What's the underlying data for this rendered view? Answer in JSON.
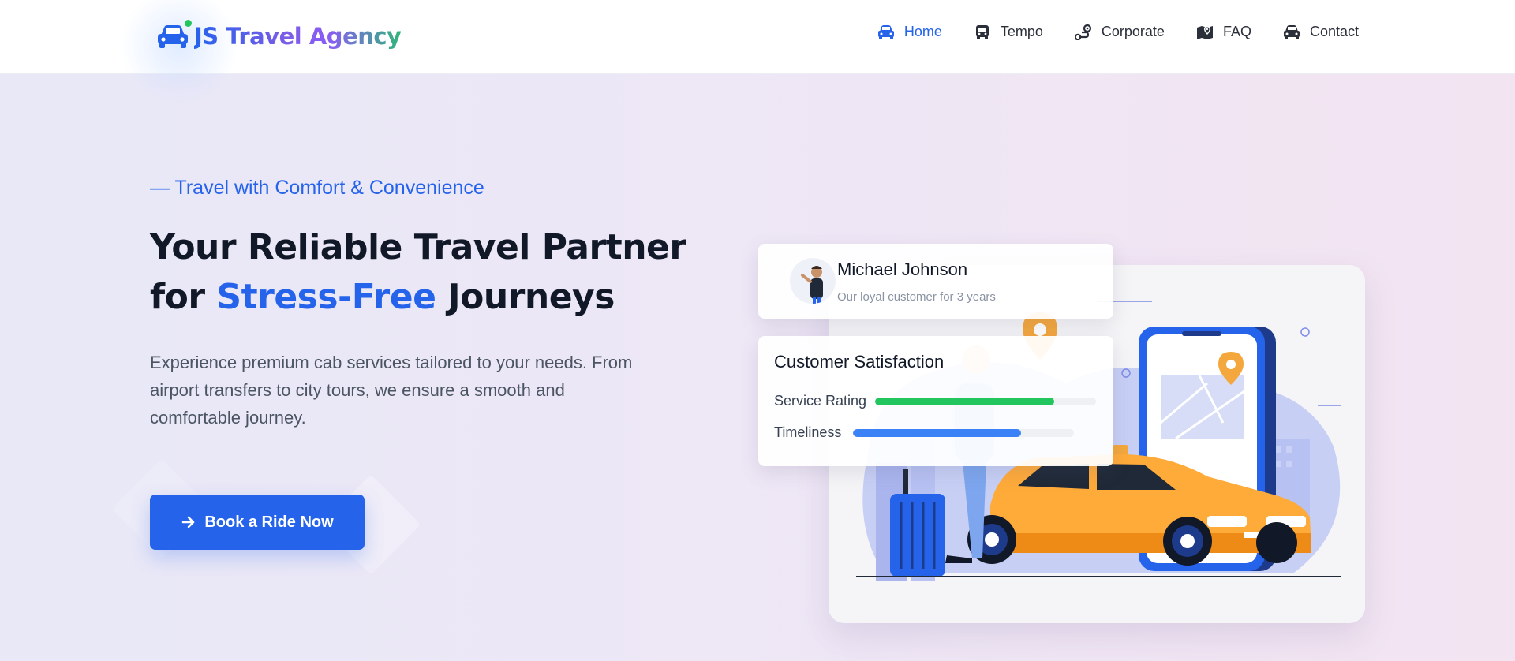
{
  "header": {
    "brand": "JS Travel Agency",
    "nav": [
      {
        "label": "Home",
        "icon": "car-front-icon",
        "active": true
      },
      {
        "label": "Tempo",
        "icon": "van-icon",
        "active": false
      },
      {
        "label": "Corporate",
        "icon": "route-icon",
        "active": false
      },
      {
        "label": "FAQ",
        "icon": "map-pin-icon",
        "active": false
      },
      {
        "label": "Contact",
        "icon": "car-icon",
        "active": false
      }
    ]
  },
  "hero": {
    "tagline": "— Travel with Comfort & Convenience",
    "headline_line1": "Your Reliable Travel Partner",
    "headline_for": "for ",
    "headline_accent": "Stress-Free",
    "headline_end": " Journeys",
    "description": "Experience premium cab services tailored to your needs. From airport transfers to city tours, we ensure a smooth and comfortable journey.",
    "cta_label": "Book a Ride Now"
  },
  "customer_card": {
    "name": "Michael Johnson",
    "subtitle": "Our loyal customer for 3 years"
  },
  "satisfaction": {
    "title": "Customer Satisfaction",
    "metrics": [
      {
        "label": "Service Rating",
        "value": 0.81,
        "color": "#22c55e"
      },
      {
        "label": "Timeliness",
        "value": 0.76,
        "color": "#3b82f6"
      }
    ]
  },
  "colors": {
    "primary": "#2563eb",
    "green": "#22c55e",
    "taxi": "#ffab3a"
  }
}
